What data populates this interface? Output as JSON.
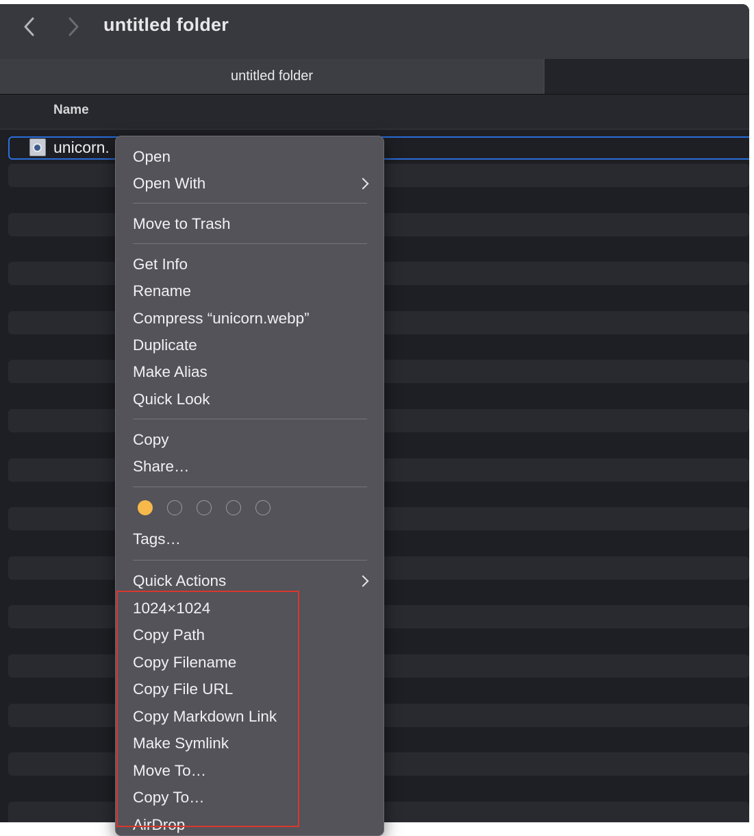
{
  "window": {
    "title": "untitled folder",
    "tab_label": "untitled folder"
  },
  "list": {
    "column_header": "Name",
    "selected_file": "unicorn.webp",
    "visible_file_text": "unicorn.\\"
  },
  "menu": {
    "groups": [
      [
        "Open",
        "Open With"
      ],
      [
        "Move to Trash"
      ],
      [
        "Get Info",
        "Rename",
        "Compress “unicorn.webp”",
        "Duplicate",
        "Make Alias",
        "Quick Look"
      ],
      [
        "Copy",
        "Share…"
      ],
      [
        "Tags…"
      ],
      [
        "Quick Actions",
        "1024×1024",
        "Copy Path",
        "Copy Filename",
        "Copy File URL",
        "Copy Markdown Link",
        "Make Symlink",
        "Move To…",
        "Copy To…",
        "AirDrop"
      ]
    ],
    "submenu_items": [
      "Open With",
      "Quick Actions"
    ],
    "tags": [
      {
        "color": "#f8b94c",
        "selected": true
      },
      {
        "color": "none",
        "selected": false
      },
      {
        "color": "none",
        "selected": false
      },
      {
        "color": "none",
        "selected": false
      },
      {
        "color": "none",
        "selected": false
      }
    ]
  },
  "annotation": {
    "color": "#d9372c"
  }
}
